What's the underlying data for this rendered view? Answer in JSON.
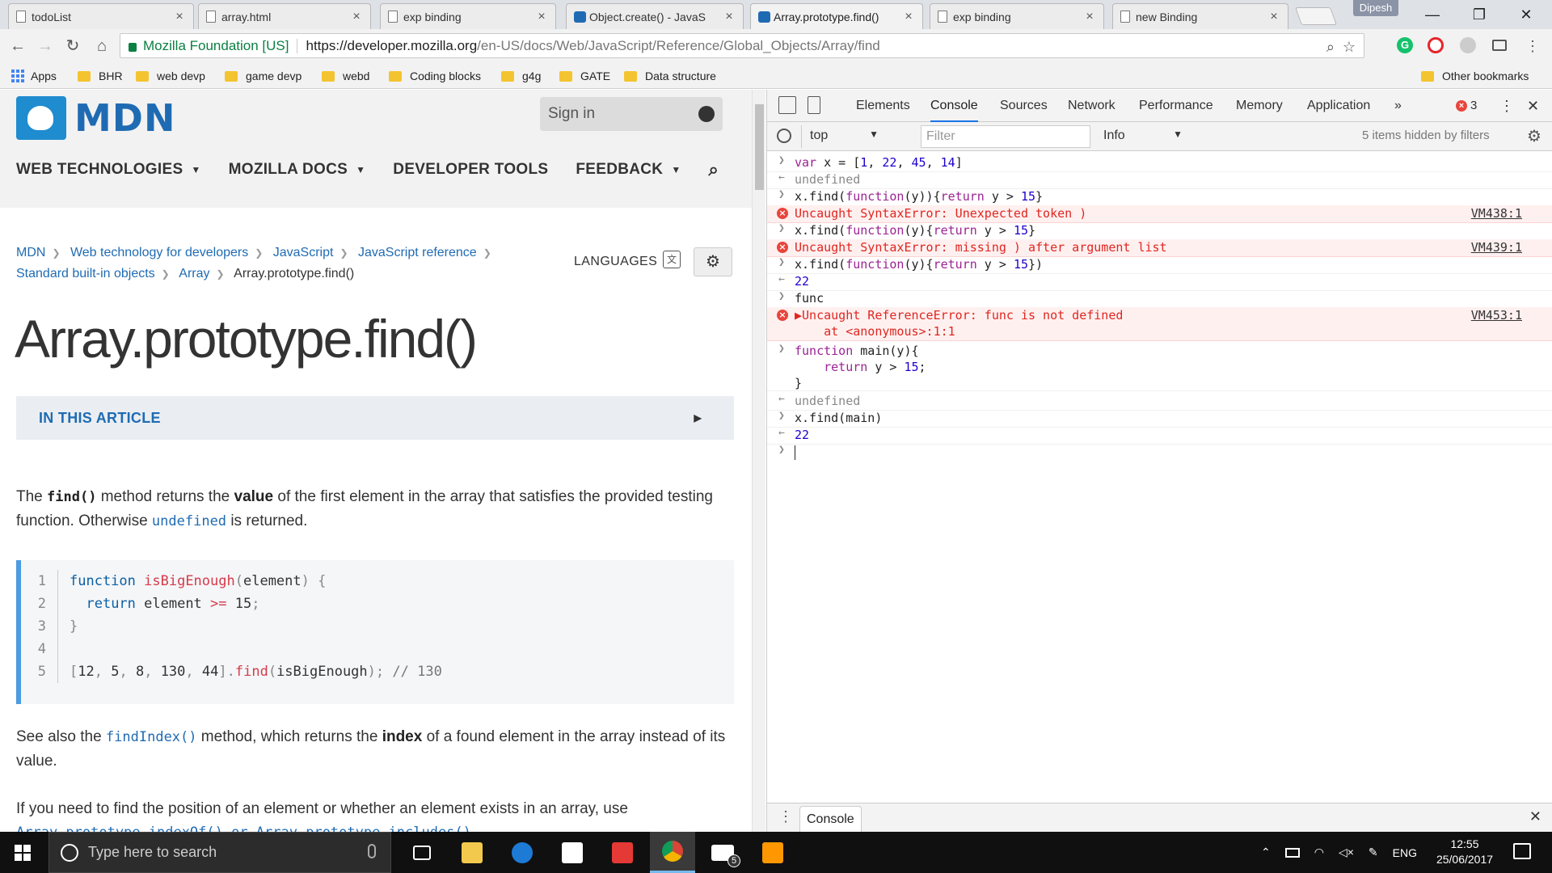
{
  "tabs": [
    {
      "title": "todoList",
      "favicon": "page-icon"
    },
    {
      "title": "array.html",
      "favicon": "page-icon"
    },
    {
      "title": "exp binding",
      "favicon": "page-icon"
    },
    {
      "title": "Object.create() - JavaS",
      "favicon": "mdn-icon"
    },
    {
      "title": "Array.prototype.find()",
      "favicon": "mdn-icon",
      "active": true
    },
    {
      "title": "exp binding",
      "favicon": "page-icon"
    },
    {
      "title": "new Binding",
      "favicon": "page-icon"
    }
  ],
  "profile_name": "Dipesh",
  "window": {
    "minimize": "—",
    "restore": "❐",
    "close": "✕"
  },
  "address": {
    "org": "Mozilla Foundation [US]",
    "host": "https://developer.mozilla.org",
    "path": "/en-US/docs/Web/JavaScript/Reference/Global_Objects/Array/find"
  },
  "bookmarks": {
    "apps": "Apps",
    "items": [
      "BHR",
      "web devp",
      "game devp",
      "webd",
      "Coding blocks",
      "g4g",
      "GATE",
      "Data structure"
    ],
    "other": "Other bookmarks"
  },
  "mdn": {
    "logo": "MDN",
    "sign_in": "Sign in",
    "nav": [
      "WEB TECHNOLOGIES",
      "MOZILLA DOCS",
      "DEVELOPER TOOLS",
      "FEEDBACK"
    ],
    "breadcrumbs": [
      "MDN",
      "Web technology for developers",
      "JavaScript",
      "JavaScript reference",
      "Standard built-in objects",
      "Array"
    ],
    "breadcrumb_current": "Array.prototype.find()",
    "languages": "LANGUAGES",
    "title": "Array.prototype.find()",
    "in_this_article": "IN THIS ARTICLE",
    "p1": {
      "a": "The ",
      "code1": "find()",
      "b": " method returns the ",
      "strong": "value",
      "c": " of the first element in the array that satisfies the provided testing function. Otherwise ",
      "code2": "undefined",
      "d": " is returned."
    },
    "code_lines": [
      "1",
      "2",
      "3",
      "4",
      "5"
    ],
    "p2": {
      "a": "See also the ",
      "code": "findIndex()",
      "b": " method, which returns the ",
      "strong": "index",
      "c": " of a found element in the array instead of its value."
    },
    "p3": "If you need to find the position of an element or whether an element exists in an array, use",
    "p3_cut": "Array.prototype.indexOf() or Array.prototype.includes()."
  },
  "devtools": {
    "tabs": [
      "Elements",
      "Console",
      "Sources",
      "Network",
      "Performance",
      "Memory",
      "Application"
    ],
    "more": "»",
    "error_count": "3",
    "context": "top",
    "filter_placeholder": "Filter",
    "level": "Info",
    "hidden": "5 items hidden by filters",
    "drawer_tab": "Console",
    "console": [
      {
        "type": "input",
        "text": "var x = [1, 22, 45, 14]"
      },
      {
        "type": "output",
        "text": "undefined"
      },
      {
        "type": "input",
        "text": "x.find(function(y)){return y > 15}"
      },
      {
        "type": "error",
        "text": "Uncaught SyntaxError: Unexpected token )",
        "loc": "VM438:1"
      },
      {
        "type": "input",
        "text": "x.find(function(y){return y > 15}"
      },
      {
        "type": "error",
        "text": "Uncaught SyntaxError: missing ) after argument list",
        "loc": "VM439:1"
      },
      {
        "type": "input",
        "text": "x.find(function(y){return y > 15})"
      },
      {
        "type": "result",
        "text": "22"
      },
      {
        "type": "input",
        "text": "func"
      },
      {
        "type": "error",
        "text": "▶Uncaught ReferenceError: func is not defined\n    at <anonymous>:1:1",
        "loc": "VM453:1"
      },
      {
        "type": "input",
        "text": "function main(y){\n    return y > 15;\n}"
      },
      {
        "type": "output",
        "text": "undefined"
      },
      {
        "type": "input",
        "text": "x.find(main)"
      },
      {
        "type": "result",
        "text": "22"
      }
    ]
  },
  "taskbar": {
    "search_placeholder": "Type here to search",
    "lang": "ENG",
    "time": "12:55",
    "date": "25/06/2017",
    "mail_badge": "5"
  },
  "colors": {
    "mdn_blue": "#1f6bb3",
    "error_red": "#e0261f",
    "devtools_accent": "#1a73e8"
  }
}
